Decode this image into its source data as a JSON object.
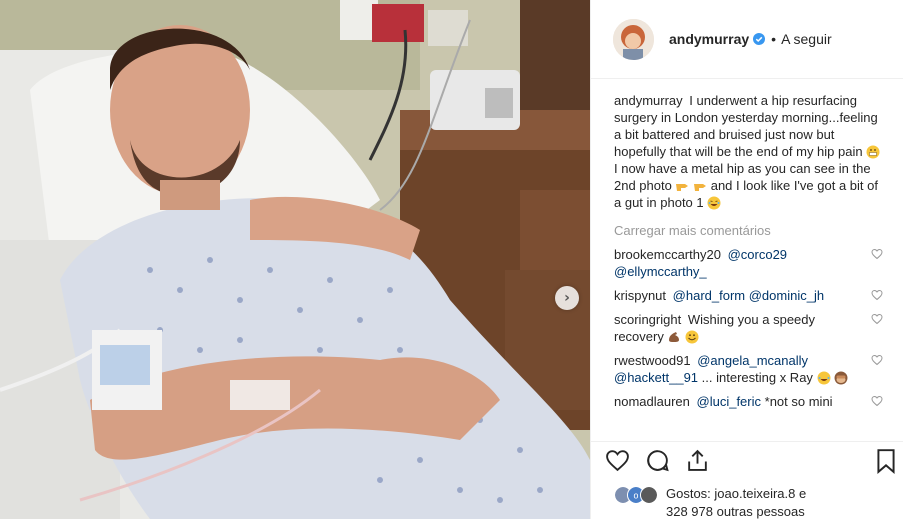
{
  "header": {
    "username": "andymurray",
    "separator": "•",
    "follow_label": "A seguir"
  },
  "caption": {
    "username": "andymurray",
    "text_1": "I underwent a hip resurfacing surgery in London yesterday morning...feeling a bit battered and bruised just now but hopefully that will be the end of my hip pain",
    "text_2": "I now have a metal hip as you can see in the 2nd photo",
    "text_3": "and I look like I've got a bit of a gut in photo 1"
  },
  "load_more_label": "Carregar mais comentários",
  "comments": [
    {
      "username": "brookemccarthy20",
      "mentions": [
        "@corco29",
        "@ellymccarthy_"
      ],
      "text": ""
    },
    {
      "username": "krispynut",
      "mentions": [
        "@hard_form",
        "@dominic_jh"
      ],
      "text": ""
    },
    {
      "username": "scoringright",
      "mentions": [],
      "text": "Wishing you a speedy recovery"
    },
    {
      "username": "rwestwood91",
      "mentions": [
        "@angela_mcanally",
        "@hackett__91"
      ],
      "text": "... interesting x Ray"
    },
    {
      "username": "nomadlauren",
      "mentions": [
        "@luci_feric"
      ],
      "text": "*not so mini"
    }
  ],
  "likes": {
    "prefix": "Gostos:",
    "first_liker": "joao.teixeira.8",
    "connector": "e",
    "others": "328 978 outras pessoas"
  },
  "icons": {
    "like": "heart-icon",
    "comment": "comment-icon",
    "share": "share-icon",
    "save": "bookmark-icon",
    "next": "chevron-right-icon",
    "verified": "verified-badge-icon"
  },
  "colors": {
    "mention": "#003569",
    "verified": "#3897f0",
    "muted": "#999999"
  }
}
